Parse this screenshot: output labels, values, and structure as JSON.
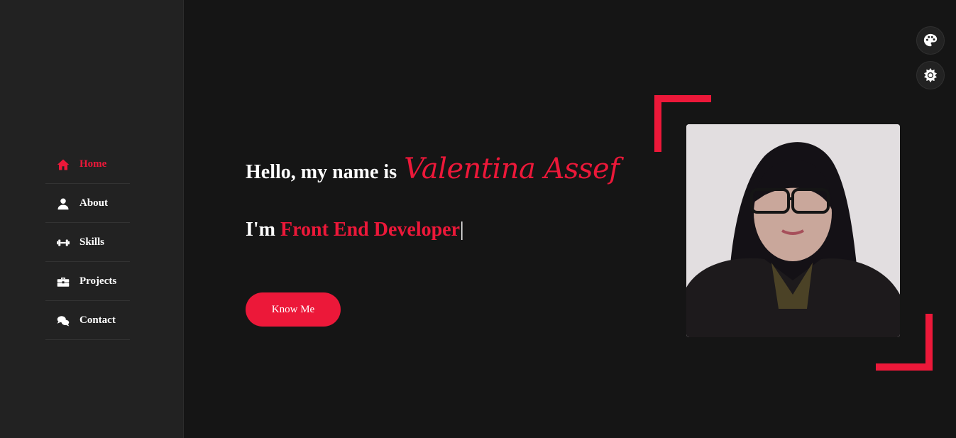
{
  "nav": {
    "items": [
      {
        "label": "Home",
        "icon": "home-icon",
        "active": true
      },
      {
        "label": "About",
        "icon": "user-icon"
      },
      {
        "label": "Skills",
        "icon": "dumbbell-icon"
      },
      {
        "label": "Projects",
        "icon": "briefcase-icon"
      },
      {
        "label": "Contact",
        "icon": "comments-icon"
      }
    ]
  },
  "hero": {
    "greeting": "Hello, my name is",
    "name": "Valentina Assef",
    "role_prefix": "I'm",
    "role": "Front End Developer",
    "cursor": "|",
    "button_label": "Know Me"
  },
  "colors": {
    "accent": "#ec1839",
    "background": "#151515",
    "sidebar": "#222222",
    "text": "#ffffff"
  },
  "toolbar": {
    "palette_icon": "palette-icon",
    "theme_icon": "sun-icon"
  }
}
